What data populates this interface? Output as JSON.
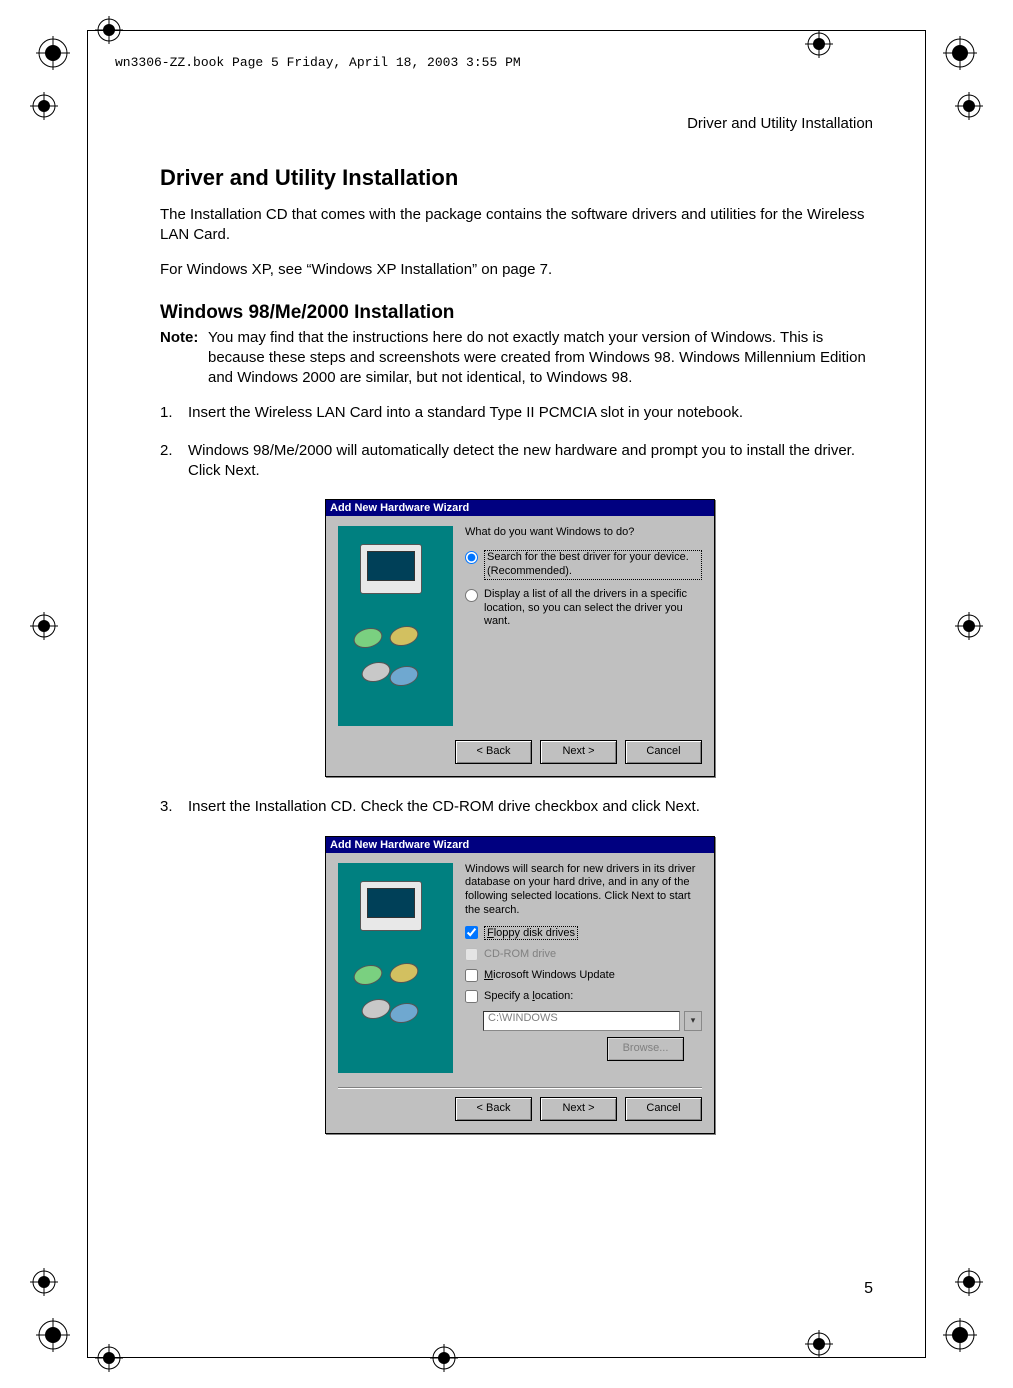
{
  "print_header": "wn3306-ZZ.book  Page 5  Friday, April 18, 2003  3:55 PM",
  "running_head": "Driver and Utility Installation",
  "page_number": "5",
  "h1": "Driver and Utility Installation",
  "p1": "The Installation CD that comes with the package contains the software drivers and utilities for the Wireless LAN Card.",
  "p2": "For Windows XP, see “Windows XP Installation” on page 7.",
  "h2": "Windows 98/Me/2000 Installation",
  "note_label": "Note:",
  "note_body": "You may find that the instructions here do not exactly match your version of Windows. This is because these steps and screenshots were created from Windows 98. Windows Millennium Edition and Windows 2000 are similar, but not identical, to Windows 98.",
  "steps": {
    "1": {
      "num": "1.",
      "text": "Insert the Wireless LAN Card into a standard Type II PCMCIA slot in your notebook."
    },
    "2": {
      "num": "2.",
      "text": "Windows 98/Me/2000 will automatically detect the new hardware and prompt you to install the driver. Click Next."
    },
    "3": {
      "num": "3.",
      "text": "Insert the Installation CD. Check the CD-ROM drive checkbox and click Next."
    }
  },
  "dialog1": {
    "title": "Add New Hardware Wizard",
    "question": "What do you want Windows to do?",
    "opt1": "Search for the best driver for your device. (Recommended).",
    "opt2": "Display a list of all the drivers in a specific location, so you can select the driver you want.",
    "back": "< Back",
    "next": "Next >",
    "cancel": "Cancel"
  },
  "dialog2": {
    "title": "Add New Hardware Wizard",
    "intro": "Windows will search for new drivers in its driver database on your hard drive, and in any of the following selected locations. Click Next to start the search.",
    "chk_floppy": "Floppy disk drives",
    "chk_cd": "CD-ROM drive",
    "chk_wu": "Microsoft Windows Update",
    "chk_loc": "Specify a location:",
    "path": "C:\\WINDOWS",
    "browse": "Browse...",
    "back": "< Back",
    "next": "Next >",
    "cancel": "Cancel"
  }
}
